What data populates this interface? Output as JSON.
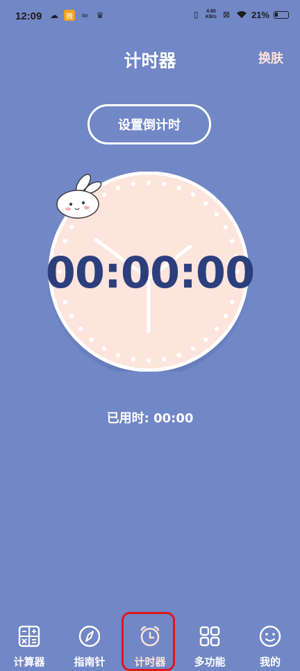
{
  "status_bar": {
    "time": "12:09",
    "net_speed_value": "4.60",
    "net_speed_unit": "KB/s",
    "battery_percent": "21%"
  },
  "header": {
    "title": "计时器",
    "skin_label": "换肤"
  },
  "countdown": {
    "set_button_label": "设置倒计时",
    "time": "00:00:00"
  },
  "elapsed": {
    "label": "已用时:",
    "value": "00:00"
  },
  "tabs": [
    {
      "label": "计算器",
      "icon": "calculator-icon"
    },
    {
      "label": "指南针",
      "icon": "compass-icon"
    },
    {
      "label": "计时器",
      "icon": "alarm-clock-icon",
      "active": true
    },
    {
      "label": "多功能",
      "icon": "grid-icon"
    },
    {
      "label": "我的",
      "icon": "smiley-icon"
    }
  ],
  "colors": {
    "background": "#7187c6",
    "clock_face": "#fde4dc",
    "time_text": "#2c3f7c",
    "highlight": "#e0161c"
  }
}
